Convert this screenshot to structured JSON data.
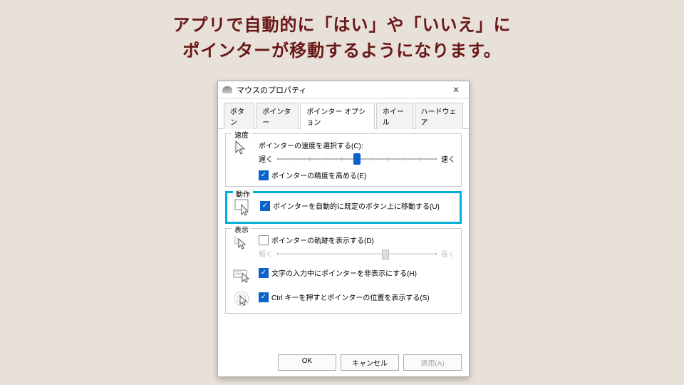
{
  "headline": {
    "line1": "アプリで自動的に「はい」や「いいえ」に",
    "line2": "ポインターが移動するようになります。"
  },
  "dialog": {
    "title": "マウスのプロパティ",
    "tabs": [
      "ボタン",
      "ポインター",
      "ポインター オプション",
      "ホイール",
      "ハードウェア"
    ],
    "active_tab": 2,
    "groups": {
      "speed": {
        "label": "速度",
        "caption": "ポインターの速度を選択する(C):",
        "slow": "遅く",
        "fast": "速く",
        "precision": "ポインターの精度を高める(E)"
      },
      "action": {
        "label": "動作",
        "snap": "ポインターを自動的に既定のボタン上に移動する(U)"
      },
      "display": {
        "label": "表示",
        "trails": "ポインターの軌跡を表示する(D)",
        "short": "短く",
        "long": "長く",
        "hide_typing": "文字の入力中にポインターを非表示にする(H)",
        "ctrl_locate": "Ctrl キーを押すとポインターの位置を表示する(S)"
      }
    },
    "buttons": {
      "ok": "OK",
      "cancel": "キャンセル",
      "apply": "適用(A)"
    }
  }
}
